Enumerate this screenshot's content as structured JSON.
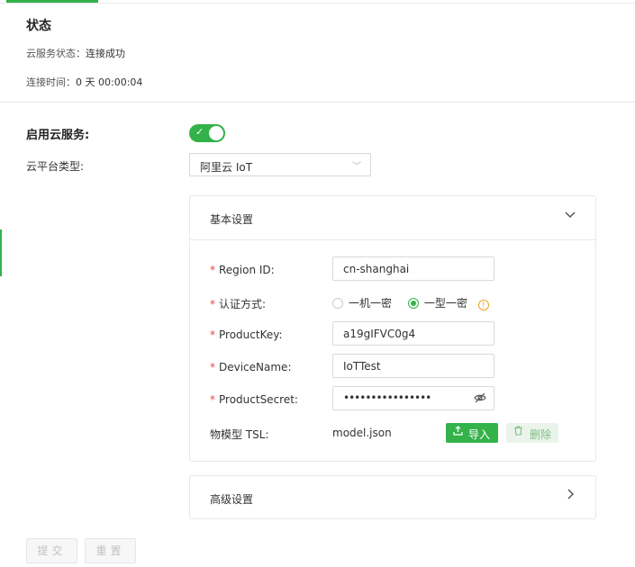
{
  "status": {
    "title": "状态",
    "cloud_status_label": "云服务状态：",
    "cloud_status_value": "连接成功",
    "connect_time_label": "连接时间：",
    "connect_time_value": "0 天 00:00:04"
  },
  "form": {
    "enable_label": "启用云服务:",
    "enabled": true,
    "platform_label": "云平台类型:",
    "platform_value": "阿里云 IoT"
  },
  "basic": {
    "title": "基本设置",
    "region_label": "Region ID:",
    "region_value": "cn-shanghai",
    "auth_label": "认证方式:",
    "auth_option_1": "一机一密",
    "auth_option_2": "一型一密",
    "auth_selected": "一型一密",
    "productkey_label": "ProductKey:",
    "productkey_value": "a19gIFVC0g4",
    "devicename_label": "DeviceName:",
    "devicename_value": "IoTTest",
    "productsecret_label": "ProductSecret:",
    "productsecret_value": "••••••••••••••••",
    "tsl_label": "物模型 TSL:",
    "tsl_file": "model.json",
    "import_label": "导入",
    "delete_label": "删除"
  },
  "advanced": {
    "title": "高级设置"
  },
  "actions": {
    "submit_label": "提交",
    "reset_label": "重置"
  },
  "colors": {
    "accent": "#34b24a",
    "required": "#e64545",
    "warning": "#f0a020"
  },
  "icons": [
    "check-icon",
    "chevron-down-icon",
    "chevron-right-icon",
    "info-icon",
    "eye-off-icon",
    "upload-icon",
    "trash-icon"
  ]
}
